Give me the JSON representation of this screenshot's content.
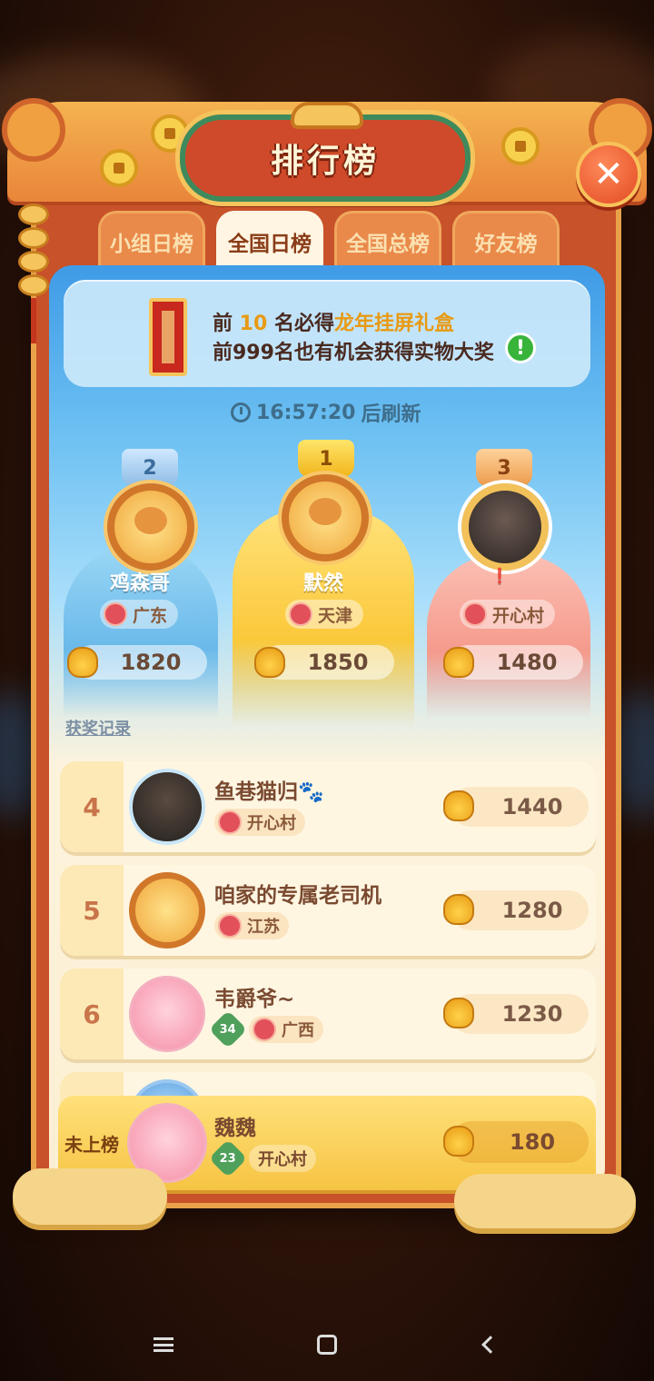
{
  "title": "排行榜",
  "close_label": "✕",
  "tabs": [
    {
      "label": "小组日榜",
      "active": false
    },
    {
      "label": "全国日榜",
      "active": true
    },
    {
      "label": "全国总榜",
      "active": false
    },
    {
      "label": "好友榜",
      "active": false
    }
  ],
  "notice": {
    "line1_prefix": "前 ",
    "line1_num": "10",
    "line1_mid": " 名必得",
    "line1_prize": "龙年挂屏礼盒",
    "line2": "前999名也有机会获得实物大奖",
    "info_icon": "!"
  },
  "refresh": {
    "time": "16:57:20",
    "suffix": "后刷新"
  },
  "top3": [
    {
      "rank": "2",
      "name": "鸡森哥",
      "region": "广东",
      "score": "1820"
    },
    {
      "rank": "1",
      "name": "默然",
      "region": "天津",
      "score": "1850"
    },
    {
      "rank": "3",
      "name": "❗",
      "region": "开心村",
      "score": "1480"
    }
  ],
  "award_link": "获奖记录",
  "rows": [
    {
      "rank": "4",
      "name": "鱼巷猫归🐾",
      "region": "开心村",
      "score": "1440",
      "level": ""
    },
    {
      "rank": "5",
      "name": "咱家的专属老司机",
      "region": "江苏",
      "score": "1280",
      "level": ""
    },
    {
      "rank": "6",
      "name": "韦爵爷~",
      "region": "广西",
      "score": "1230",
      "level": "34"
    }
  ],
  "me": {
    "rank": "未上榜",
    "name": "魏魏",
    "level": "23",
    "region": "开心村",
    "score": "180"
  },
  "colors": {
    "frame": "#c8522a",
    "accent_gold": "#e89a14",
    "tab_active": "#fff5e2"
  }
}
